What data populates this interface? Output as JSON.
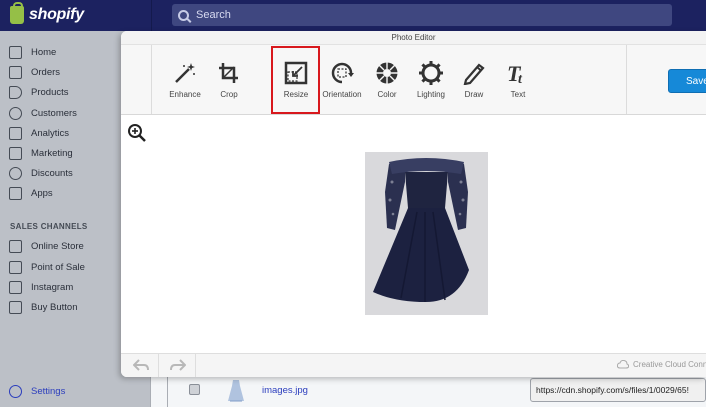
{
  "brand": {
    "name": "shopify"
  },
  "search": {
    "placeholder": "Search"
  },
  "sidebar": {
    "items": [
      {
        "label": "Home",
        "icon": "home-icon"
      },
      {
        "label": "Orders",
        "icon": "orders-icon"
      },
      {
        "label": "Products",
        "icon": "tag-icon"
      },
      {
        "label": "Customers",
        "icon": "user-icon"
      },
      {
        "label": "Analytics",
        "icon": "bar-chart-icon"
      },
      {
        "label": "Marketing",
        "icon": "megaphone-icon"
      },
      {
        "label": "Discounts",
        "icon": "discount-icon"
      },
      {
        "label": "Apps",
        "icon": "apps-icon"
      }
    ],
    "section_title": "SALES CHANNELS",
    "channels": [
      {
        "label": "Online Store",
        "icon": "store-icon"
      },
      {
        "label": "Point of Sale",
        "icon": "pos-icon"
      },
      {
        "label": "Instagram",
        "icon": "instagram-icon"
      },
      {
        "label": "Buy Button",
        "icon": "buy-button-icon"
      }
    ],
    "settings": {
      "label": "Settings",
      "icon": "gear-icon"
    }
  },
  "background_row": {
    "filename": "images.jpg",
    "url": "https://cdn.shopify.com/s/files/1/0029/65!"
  },
  "editor": {
    "title": "Photo Editor",
    "tools": [
      {
        "label": "Enhance",
        "icon": "magic-wand-icon"
      },
      {
        "label": "Crop",
        "icon": "crop-icon"
      },
      {
        "label": "Resize",
        "icon": "resize-icon",
        "selected": true
      },
      {
        "label": "Orientation",
        "icon": "rotate-icon"
      },
      {
        "label": "Color",
        "icon": "color-wheel-icon"
      },
      {
        "label": "Lighting",
        "icon": "sun-gear-icon"
      },
      {
        "label": "Draw",
        "icon": "pencil-icon"
      },
      {
        "label": "Text",
        "icon": "text-icon"
      }
    ],
    "save_label": "Save",
    "footer_label": "Creative Cloud Conn",
    "accent": "#1689d8",
    "highlight_color": "#d8181d"
  }
}
